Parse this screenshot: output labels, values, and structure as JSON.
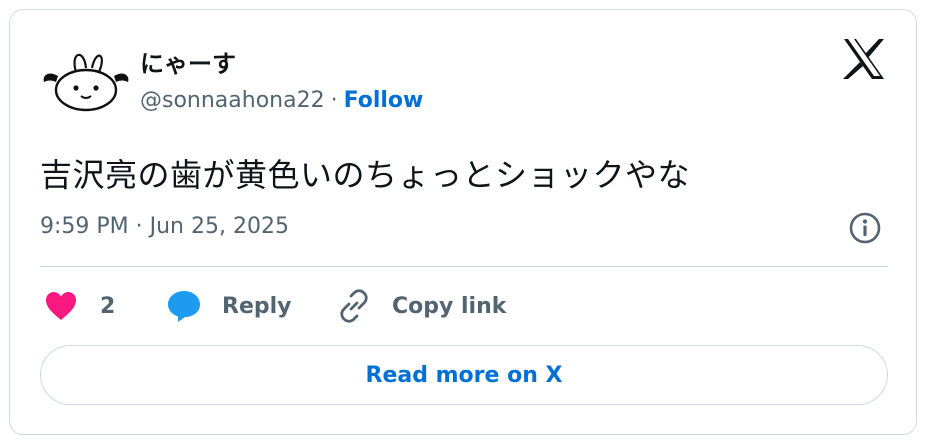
{
  "user": {
    "display_name": "にゃーす",
    "handle": "@sonnaahona22",
    "separator": "·",
    "follow_label": "Follow",
    "avatar_icon": "bunny-avatar"
  },
  "brand": {
    "logo_icon": "x-logo-icon"
  },
  "tweet": {
    "text": "吉沢亮の歯が黄色いのちょっとショックやな",
    "timestamp": "9:59 PM · Jun 25, 2025"
  },
  "actions": {
    "like_count": "2",
    "reply_label": "Reply",
    "copy_label": "Copy link"
  },
  "footer": {
    "read_more_label": "Read more on X"
  },
  "colors": {
    "like": "#f91880",
    "reply": "#1d9bf0",
    "link_blue": "#006fd6",
    "muted": "#536471",
    "border": "#cfd9de"
  }
}
